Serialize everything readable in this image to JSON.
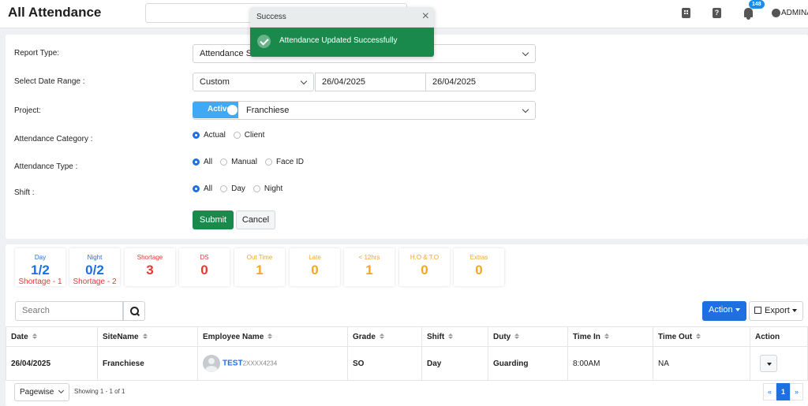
{
  "header": {
    "title": "All Attendance",
    "notification_count": "148",
    "user_name": "ADMINA",
    "help_glyph": "?"
  },
  "toast": {
    "title": "Success",
    "message": "Attendance Updated Successfully",
    "close_glyph": "×"
  },
  "form": {
    "report_type_label": "Report Type:",
    "report_type_value": "Attendance S",
    "date_range_label": "Select Date Range :",
    "date_range_value": "Custom",
    "date_from": "26/04/2025",
    "date_to": "26/04/2025",
    "project_label": "Project:",
    "project_toggle_label": "Active",
    "project_value": "Franchiese",
    "category_label": "Attendance Category :",
    "category_options": [
      "Actual",
      "Client"
    ],
    "type_label": "Attendance Type :",
    "type_options": [
      "All",
      "Manual",
      "Face ID"
    ],
    "shift_label": "Shift :",
    "shift_options": [
      "All",
      "Day",
      "Night"
    ],
    "submit_label": "Submit",
    "cancel_label": "Cancel"
  },
  "stats": [
    {
      "label": "Day",
      "value": "1/2",
      "sub": "Shortage - 1",
      "color": "#1e6fe0"
    },
    {
      "label": "Night",
      "value": "0/2",
      "sub": "Shortage - 2",
      "color": "#1e6fe0"
    },
    {
      "label": "Shortage",
      "value": "3",
      "color": "#e53935"
    },
    {
      "label": "DS",
      "value": "0",
      "color": "#e53935"
    },
    {
      "label": "Out Time",
      "value": "1",
      "color": "#f5a623"
    },
    {
      "label": "Late",
      "value": "0",
      "color": "#f5a623"
    },
    {
      "label": "< 12hrs",
      "value": "1",
      "color": "#f5a623"
    },
    {
      "label": "H.O & T.O",
      "value": "0",
      "color": "#f5a623"
    },
    {
      "label": "Extras",
      "value": "0",
      "color": "#f5a623"
    }
  ],
  "toolbar": {
    "search_placeholder": "Search",
    "action_label": "Action",
    "export_label": "Export"
  },
  "table": {
    "columns": [
      "Date",
      "SiteName",
      "Employee Name",
      "Grade",
      "Shift",
      "Duty",
      "Time In",
      "Time Out",
      "Action"
    ],
    "rows": [
      {
        "date": "26/04/2025",
        "site": "Franchiese",
        "employee_name": "TEST",
        "employee_code": "2XXXX4234",
        "grade": "SO",
        "shift": "Day",
        "duty": "Guarding",
        "time_in": "8:00AM",
        "time_out": "NA"
      }
    ]
  },
  "footer": {
    "page_size": "Pagewise",
    "showing": "Showing 1 - 1 of 1",
    "pages": [
      "«",
      "1",
      "»"
    ]
  }
}
